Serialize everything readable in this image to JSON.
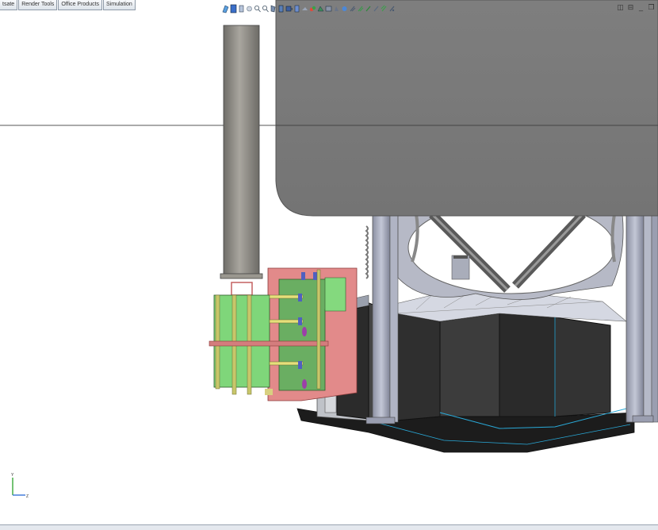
{
  "command_manager": {
    "tabs": [
      {
        "label": "tsate"
      },
      {
        "label": "Render Tools"
      },
      {
        "label": "Office Products"
      },
      {
        "label": "Simulation"
      }
    ]
  },
  "heads_up_toolbar": {
    "icons": [
      "previous-view-icon",
      "zoom-to-fit-icon",
      "zoom-to-area-icon",
      "zoom-in-out-icon",
      "rotate-icon",
      "pan-icon",
      "section-view-icon",
      "view-orientation-icon",
      "display-style-icon",
      "hide-show-items-icon",
      "edit-appearance-icon",
      "apply-scene-icon",
      "view-settings-icon",
      "realview-icon",
      "shadows-icon",
      "ambient-occlusion-icon",
      "perspective-icon",
      "cartoon-icon",
      "camera-icon",
      "curvature-icon",
      "zebra-stripes-icon",
      "display-pane-icon"
    ]
  },
  "window_controls": {
    "buttons": [
      {
        "name": "tile-window-button",
        "glyph": "◫"
      },
      {
        "name": "split-window-button",
        "glyph": "⊟"
      },
      {
        "name": "minimize-button",
        "glyph": "_"
      },
      {
        "name": "restore-button",
        "glyph": "❐"
      }
    ]
  },
  "model_colors": {
    "tank": "#7d7d7d",
    "stack": "#8c8a84",
    "damper_green": "#7fd67a",
    "flange_red": "#e08080",
    "enclosure_dark": "#3a3a3a",
    "column_blue_gray": "#a6aabb",
    "edge_cyan": "#29a9d8"
  },
  "triad": {
    "y_label": "Y",
    "z_label": "Z"
  }
}
